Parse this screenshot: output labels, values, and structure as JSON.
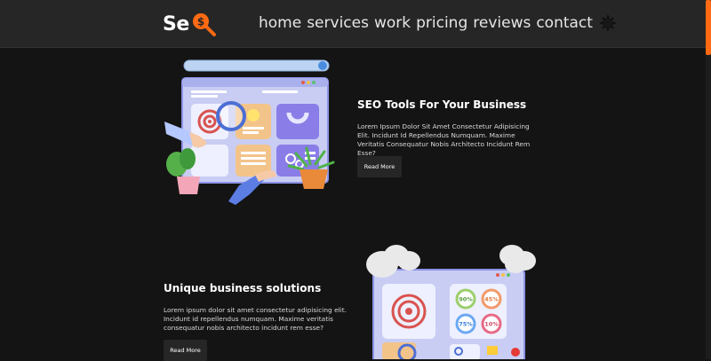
{
  "brand": {
    "name": "Se",
    "accent": "#ff6a13"
  },
  "nav": {
    "items": [
      "home",
      "services",
      "work",
      "pricing",
      "reviews",
      "contact"
    ],
    "settings_icon": "gear-icon"
  },
  "section1": {
    "title": "SEO Tools For Your Business",
    "body": "Lorem Ipsum Dolor Sit Amet Consectetur Adipisicing Elit. Incidunt Id Repellendus Numquam. Maxime Veritatis Consequatur Nobis Architecto Incidunt Rem Esse?",
    "button": "Read More"
  },
  "section2": {
    "title": "Unique business solutions",
    "body": "Lorem ipsum dolor sit amet consectetur adipisicing elit. Incidunt id repellendus numquam. Maxime veritatis consequatur nobis architecto incidunt rem esse?",
    "button": "Read More",
    "stats": [
      "90%",
      "45%",
      "75%",
      "10%"
    ]
  }
}
